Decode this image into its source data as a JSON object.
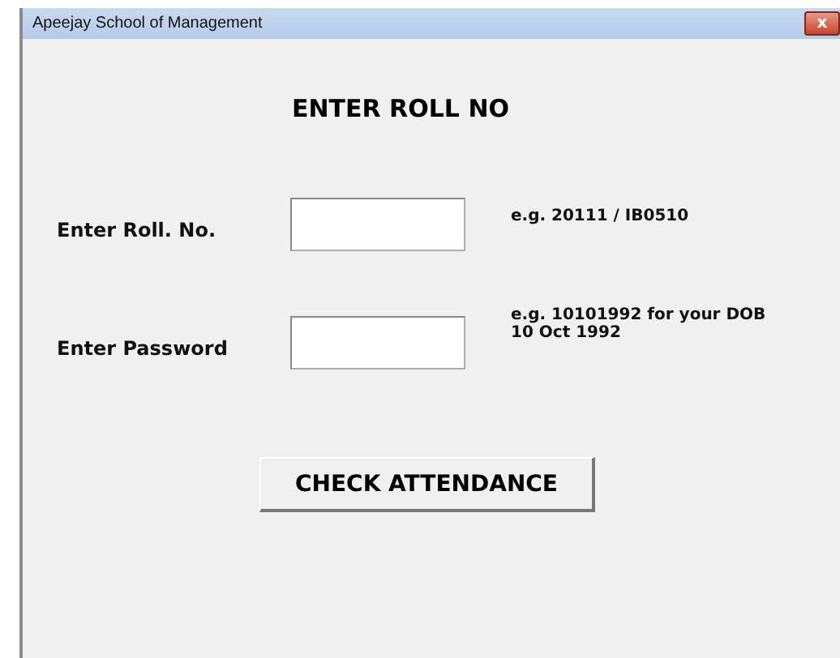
{
  "window": {
    "title": "Apeejay School of Management",
    "close": "x"
  },
  "heading": "ENTER ROLL NO",
  "fields": [
    {
      "label": "Enter Roll. No.",
      "hint": "e.g.  20111 / IB0510"
    },
    {
      "label": "Enter Password",
      "hint": "e.g.  10101992 for your DOB\n10 Oct 1992"
    }
  ],
  "button": "CHECK ATTENDANCE"
}
